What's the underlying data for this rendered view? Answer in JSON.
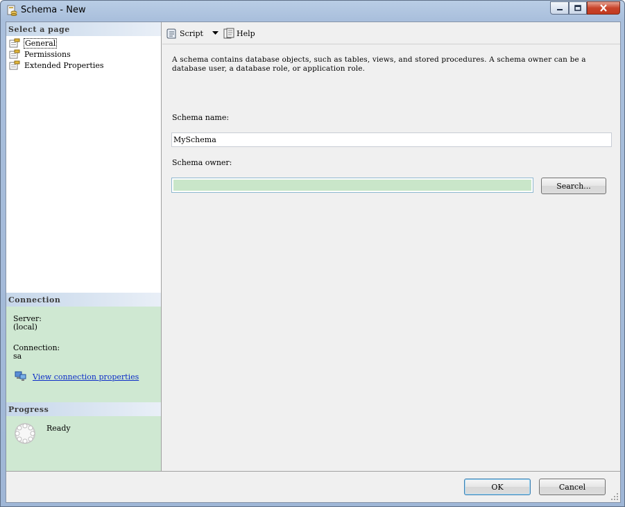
{
  "window": {
    "title": "Schema - New",
    "controls": [
      "minimize-icon",
      "maximize-icon",
      "close-icon"
    ]
  },
  "left_panel": {
    "select_page_header": "Select a page",
    "pages": [
      {
        "label": "General",
        "icon": "page-settings-icon",
        "selected": true
      },
      {
        "label": "Permissions",
        "icon": "page-settings-icon",
        "selected": false
      },
      {
        "label": "Extended Properties",
        "icon": "page-settings-icon",
        "selected": false
      }
    ],
    "connection": {
      "header": "Connection",
      "server_label": "Server:",
      "server_value": "(local)",
      "connection_label": "Connection:",
      "connection_value": "sa",
      "view_link": "View connection properties"
    },
    "progress": {
      "header": "Progress",
      "status": "Ready"
    }
  },
  "toolbar": {
    "script_label": "Script",
    "help_label": "Help"
  },
  "general": {
    "description": "A schema contains database objects, such as tables, views, and stored procedures. A schema owner can be a database user, a database role, or application role.",
    "schema_name_label": "Schema name:",
    "schema_name_value": "MySchema",
    "schema_owner_label": "Schema owner:",
    "schema_owner_value": "",
    "search_button": "Search..."
  },
  "footer": {
    "ok_label": "OK",
    "cancel_label": "Cancel"
  },
  "colors": {
    "panel_green": "#cfe8d2",
    "header_blue": "#c6d7ea",
    "link_blue": "#0b2cc7",
    "close_red": "#c8442b"
  }
}
